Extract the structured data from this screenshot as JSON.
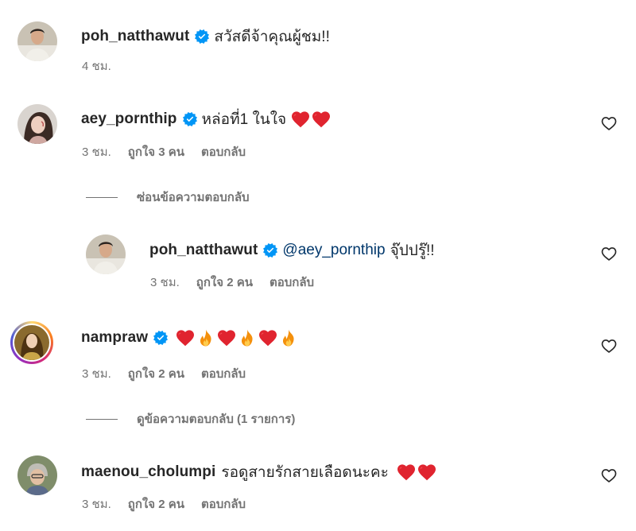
{
  "comments": [
    {
      "username": "poh_natthawut",
      "text": "สวัสดีจ้าคุณผู้ชม!!",
      "time": "4 ชม."
    },
    {
      "username": "aey_pornthip",
      "text": "หล่อที่1 ในใจ",
      "emojis": [
        "heart-emoji",
        "heart-emoji"
      ],
      "time": "3 ชม.",
      "likes": "ถูกใจ 3 คน",
      "reply": "ตอบกลับ",
      "thread_toggle": "ซ่อนข้อความตอบกลับ"
    },
    {
      "username": "poh_natthawut",
      "mention": "@aey_pornthip",
      "text": "จุ๊ปปรู๊!!",
      "time": "3 ชม.",
      "likes": "ถูกใจ 2 คน",
      "reply": "ตอบกลับ"
    },
    {
      "username": "nampraw",
      "emojis": [
        "heart-emoji",
        "fire-emoji",
        "heart-emoji",
        "fire-emoji",
        "heart-emoji",
        "fire-emoji"
      ],
      "time": "3 ชม.",
      "likes": "ถูกใจ 2 คน",
      "reply": "ตอบกลับ",
      "thread_toggle": "ดูข้อความตอบกลับ (1 รายการ)"
    },
    {
      "username": "maenou_cholumpi",
      "text": "รอดูสายรักสายเลือดนะคะ",
      "emojis": [
        "heart-emoji",
        "heart-emoji"
      ],
      "time": "3 ชม.",
      "likes": "ถูกใจ 2 คน",
      "reply": "ตอบกลับ"
    }
  ],
  "colors": {
    "verified": "#0095f6",
    "heart": "#e0242f",
    "muted": "#737373",
    "mention": "#00376b"
  }
}
